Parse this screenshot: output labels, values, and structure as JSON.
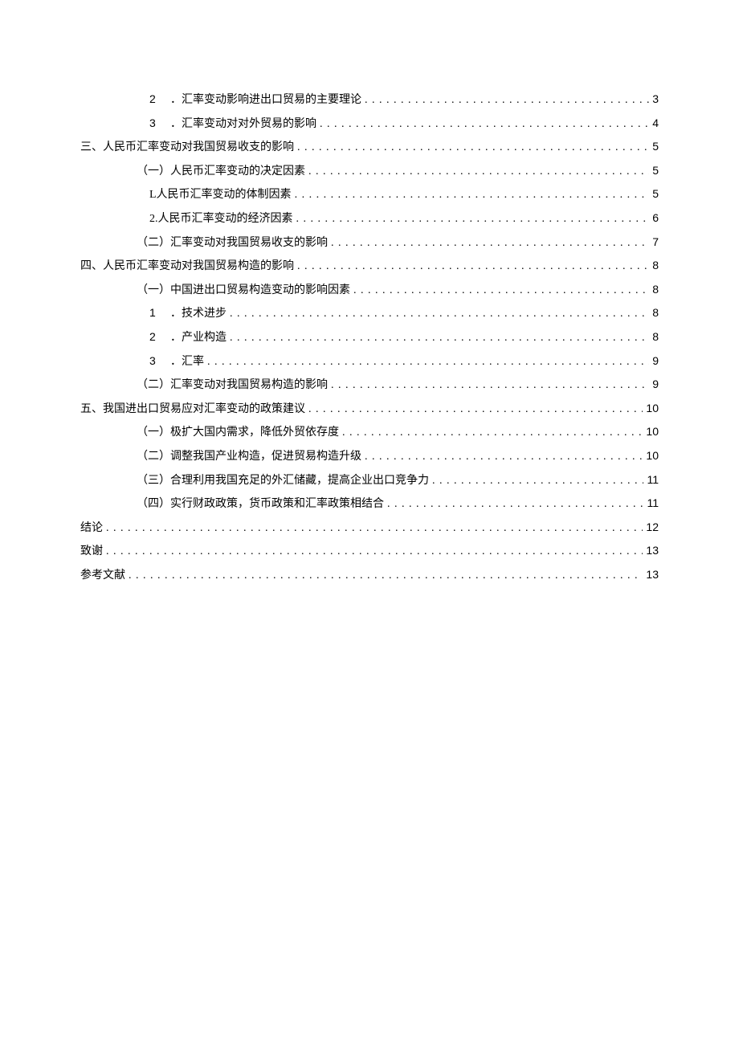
{
  "entries": [
    {
      "indent": "2n",
      "prefix": "2",
      "label": "．汇率变动影响进出口贸易的主要理论",
      "page": "3"
    },
    {
      "indent": "2n",
      "prefix": "3",
      "label": "．汇率变动对对外贸易的影响",
      "page": "4"
    },
    {
      "indent": "0",
      "prefix": "",
      "label": "三、人民币汇率变动对我国贸易收支的影响",
      "page": "5"
    },
    {
      "indent": "1",
      "prefix": "",
      "label": "（一）人民币汇率变动的决定因素",
      "page": "5"
    },
    {
      "indent": "2",
      "prefix": "",
      "label": "L人民币汇率变动的体制因素",
      "page": "5"
    },
    {
      "indent": "2",
      "prefix": "",
      "label": "2.人民币汇率变动的经济因素",
      "page": "6"
    },
    {
      "indent": "1",
      "prefix": "",
      "label": "（二）汇率变动对我国贸易收支的影响",
      "page": "7"
    },
    {
      "indent": "0",
      "prefix": "",
      "label": "四、人民币汇率变动对我国贸易构造的影响",
      "page": "8"
    },
    {
      "indent": "1",
      "prefix": "",
      "label": "（一）中国进出口贸易构造变动的影响因素",
      "page": "8"
    },
    {
      "indent": "2n",
      "prefix": "1",
      "label": "．技术进步",
      "page": "8"
    },
    {
      "indent": "2n",
      "prefix": "2",
      "label": "．产业构造",
      "page": "8"
    },
    {
      "indent": "2n",
      "prefix": "3",
      "label": "．汇率",
      "page": "9"
    },
    {
      "indent": "1",
      "prefix": "",
      "label": "（二）汇率变动对我国贸易构造的影响",
      "page": "9"
    },
    {
      "indent": "0",
      "prefix": "",
      "label": "五、我国进出口贸易应对汇率变动的政策建议",
      "page": "10"
    },
    {
      "indent": "1",
      "prefix": "",
      "label": "（一）极扩大国内需求，降低外贸依存度",
      "page": "10"
    },
    {
      "indent": "1",
      "prefix": "",
      "label": "（二）调整我国产业构造，促进贸易构造升级",
      "page": "10"
    },
    {
      "indent": "1",
      "prefix": "",
      "label": "（三）合理利用我国充足的外汇储藏，提高企业出口竞争力",
      "page": "11"
    },
    {
      "indent": "1",
      "prefix": "",
      "label": "（四）实行财政政策，货币政策和汇率政策相结合",
      "page": "11"
    },
    {
      "indent": "0",
      "prefix": "",
      "label": "结论",
      "page": "12"
    },
    {
      "indent": "0",
      "prefix": "",
      "label": "致谢",
      "page": "13"
    },
    {
      "indent": "0",
      "prefix": "",
      "label": "参考文献",
      "page": "13"
    }
  ]
}
